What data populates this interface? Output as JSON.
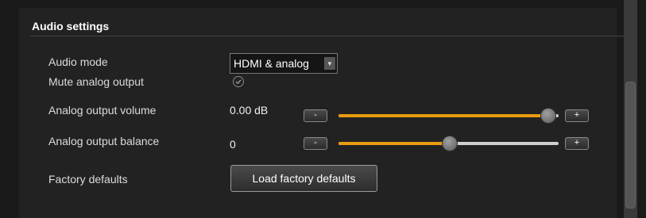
{
  "section": {
    "title": "Audio settings"
  },
  "rows": {
    "audio_mode": {
      "label": "Audio mode",
      "value": "HDMI & analog"
    },
    "mute": {
      "label": "Mute analog output",
      "checked": true
    },
    "volume": {
      "label": "Analog output volume",
      "value": "0.00 dB",
      "minus": "-",
      "plus": "+",
      "slider_fraction": 0.95
    },
    "balance": {
      "label": "Analog output balance",
      "value": "0",
      "minus": "-",
      "plus": "+",
      "slider_fraction": 0.5
    },
    "factory": {
      "label": "Factory defaults",
      "button": "Load factory defaults"
    }
  },
  "colors": {
    "accent": "#e89b10",
    "background": "#222222"
  }
}
